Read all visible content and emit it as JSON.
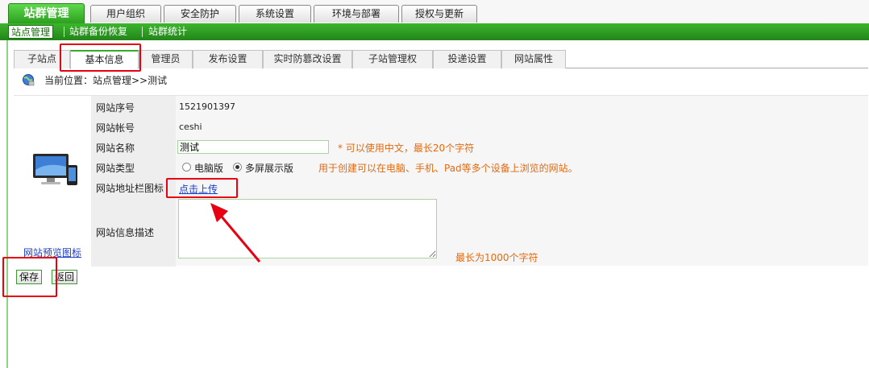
{
  "top_tabs": [
    {
      "label": "站群管理",
      "active": true
    },
    {
      "label": "用户组织",
      "active": false
    },
    {
      "label": "安全防护",
      "active": false
    },
    {
      "label": "系统设置",
      "active": false
    },
    {
      "label": "环境与部署",
      "active": false
    },
    {
      "label": "授权与更新",
      "active": false
    }
  ],
  "sub_nav": [
    {
      "label": "站点管理",
      "active": true
    },
    {
      "label": "站群备份恢复",
      "active": false
    },
    {
      "label": "站群统计",
      "active": false
    }
  ],
  "tabs": [
    {
      "label": "子站点",
      "active": false
    },
    {
      "label": "基本信息",
      "active": true
    },
    {
      "label": "管理员",
      "active": false
    },
    {
      "label": "发布设置",
      "active": false
    },
    {
      "label": "实时防篡改设置",
      "active": false
    },
    {
      "label": "子站管理权",
      "active": false
    },
    {
      "label": "投递设置",
      "active": false
    },
    {
      "label": "网站属性",
      "active": false
    }
  ],
  "breadcrumb": {
    "text": "当前位置：站点管理>>测试"
  },
  "form": {
    "preview_link": "网站预览图标",
    "site_id": {
      "label": "网站序号",
      "value": "1521901397"
    },
    "site_account": {
      "label": "网站帐号",
      "value": "ceshi"
    },
    "site_name": {
      "label": "网站名称",
      "value": "测试",
      "hint": "*  可以使用中文，最长20个字符"
    },
    "site_type": {
      "label": "网站类型",
      "options": [
        {
          "label": "电脑版",
          "selected": false
        },
        {
          "label": "多屏展示版",
          "selected": true
        }
      ],
      "hint": "用于创建可以在电脑、手机、Pad等多个设备上浏览的网站。"
    },
    "favicon": {
      "label": "网站地址栏图标",
      "link": "点击上传"
    },
    "description": {
      "label": "网站信息描述",
      "value": "",
      "hint": "最长为1000个字符"
    }
  },
  "buttons": {
    "save": "保存",
    "back": "返回"
  },
  "colors": {
    "accent_green": "#2a9d1e",
    "hint_orange": "#e26a10",
    "link_blue": "#1a3ec7",
    "annotation_red": "#e60012"
  }
}
